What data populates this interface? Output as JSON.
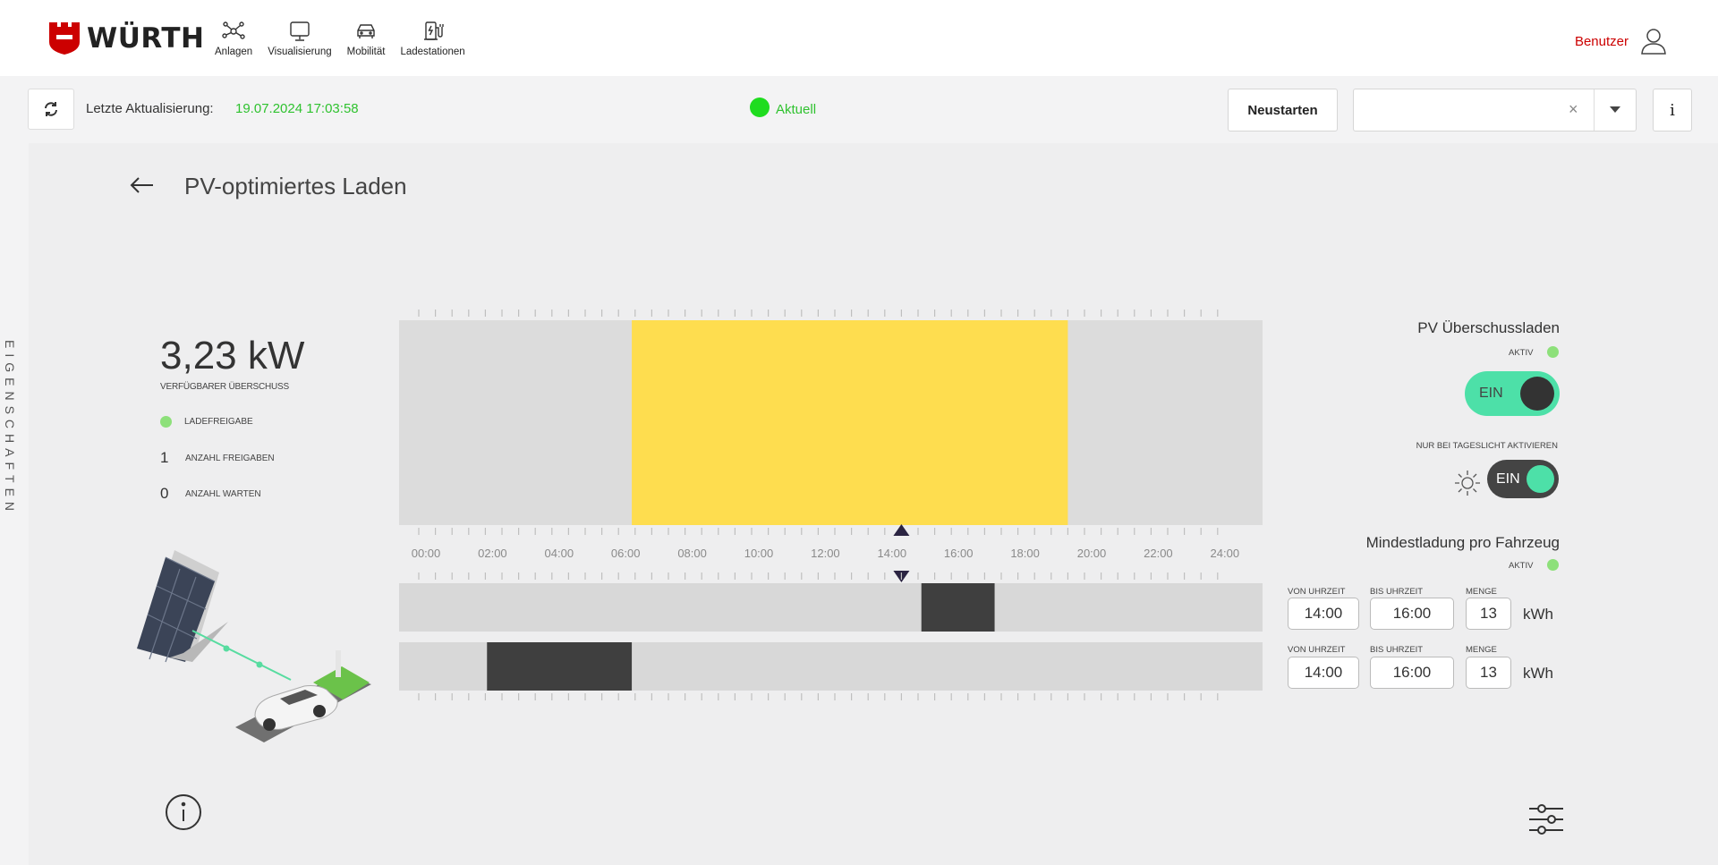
{
  "brand": {
    "logo_text": "WÜRTH",
    "accent": "#cc0000"
  },
  "nav": {
    "items": [
      {
        "label": "Anlagen",
        "icon": "network-icon"
      },
      {
        "label": "Visualisierung",
        "icon": "monitor-icon"
      },
      {
        "label": "Mobilität",
        "icon": "car-icon"
      },
      {
        "label": "Ladestationen",
        "icon": "charging-station-icon"
      }
    ]
  },
  "user": {
    "label": "Benutzer"
  },
  "toolbar": {
    "last_update_label": "Letzte Aktualisierung:",
    "last_update_value": "19.07.2024 17:03:58",
    "status_label": "Aktuell",
    "restart_label": "Neustarten",
    "select_clear": "×",
    "info_label": "i"
  },
  "side_tab": {
    "label": "EIGENSCHAFTEN"
  },
  "page": {
    "title": "PV-optimiertes Laden"
  },
  "summary": {
    "value": "3,23 kW",
    "value_label": "VERFÜGBARER ÜBERSCHUSS",
    "release_label": "LADEFREIGABE",
    "count_releases": "1",
    "count_releases_label": "ANZAHL FREIGABEN",
    "count_waiting": "0",
    "count_waiting_label": "ANZAHL WARTEN"
  },
  "timeline": {
    "hour_labels": [
      "00:00",
      "02:00",
      "04:00",
      "06:00",
      "08:00",
      "10:00",
      "12:00",
      "14:00",
      "16:00",
      "18:00",
      "20:00",
      "22:00",
      "24:00"
    ],
    "pv_window": {
      "from_hour": 6.4,
      "to_hour": 19.5
    },
    "current_hour": 14.5,
    "vehicle_slots": [
      {
        "from_hour": 15.1,
        "to_hour": 17.3
      },
      {
        "from_hour": 2.05,
        "to_hour": 6.4
      }
    ],
    "colors": {
      "pv": "#fedd4f",
      "track": "#d8d8d8",
      "slot": "#3f3f3f",
      "marker": "#2b2442"
    }
  },
  "right": {
    "pv_title": "PV Überschussladen",
    "pv_aktiv": "AKTIV",
    "pv_toggle": "EIN",
    "daylight_label": "NUR BEI TAGESLICHT AKTIVIEREN",
    "daylight_toggle": "EIN",
    "min_title": "Mindestladung pro Fahrzeug",
    "min_aktiv": "AKTIV",
    "rows": [
      {
        "von_label": "VON UHRZEIT",
        "von": "14:00",
        "bis_label": "BIS UHRZEIT",
        "bis": "16:00",
        "menge_label": "MENGE",
        "menge": "13",
        "unit": "kWh"
      },
      {
        "von_label": "VON UHRZEIT",
        "von": "14:00",
        "bis_label": "BIS UHRZEIT",
        "bis": "16:00",
        "menge_label": "MENGE",
        "menge": "13",
        "unit": "kWh"
      }
    ]
  }
}
